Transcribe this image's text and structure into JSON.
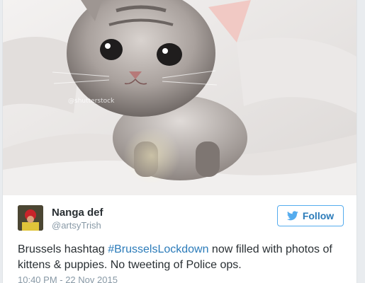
{
  "media": {
    "watermark": "@shutterstock",
    "subject_icon": "kitten-photo"
  },
  "user": {
    "display_name": "Nanga def",
    "handle": "@artsyTrish",
    "avatar_icon": "avatar-icon"
  },
  "follow_button": {
    "label": "Follow",
    "icon": "twitter-bird-icon"
  },
  "tweet": {
    "text_before": "Brussels hashtag ",
    "hashtag": "#BrusselsLockdown",
    "text_after": " now filled with photos of kittens & puppies. No tweeting of Police ops.",
    "timestamp": "10:40 PM - 22 Nov 2015"
  },
  "colors": {
    "link": "#2b7bb9",
    "follow_border": "#55acee",
    "text": "#292f33",
    "muted": "#8899a6"
  }
}
